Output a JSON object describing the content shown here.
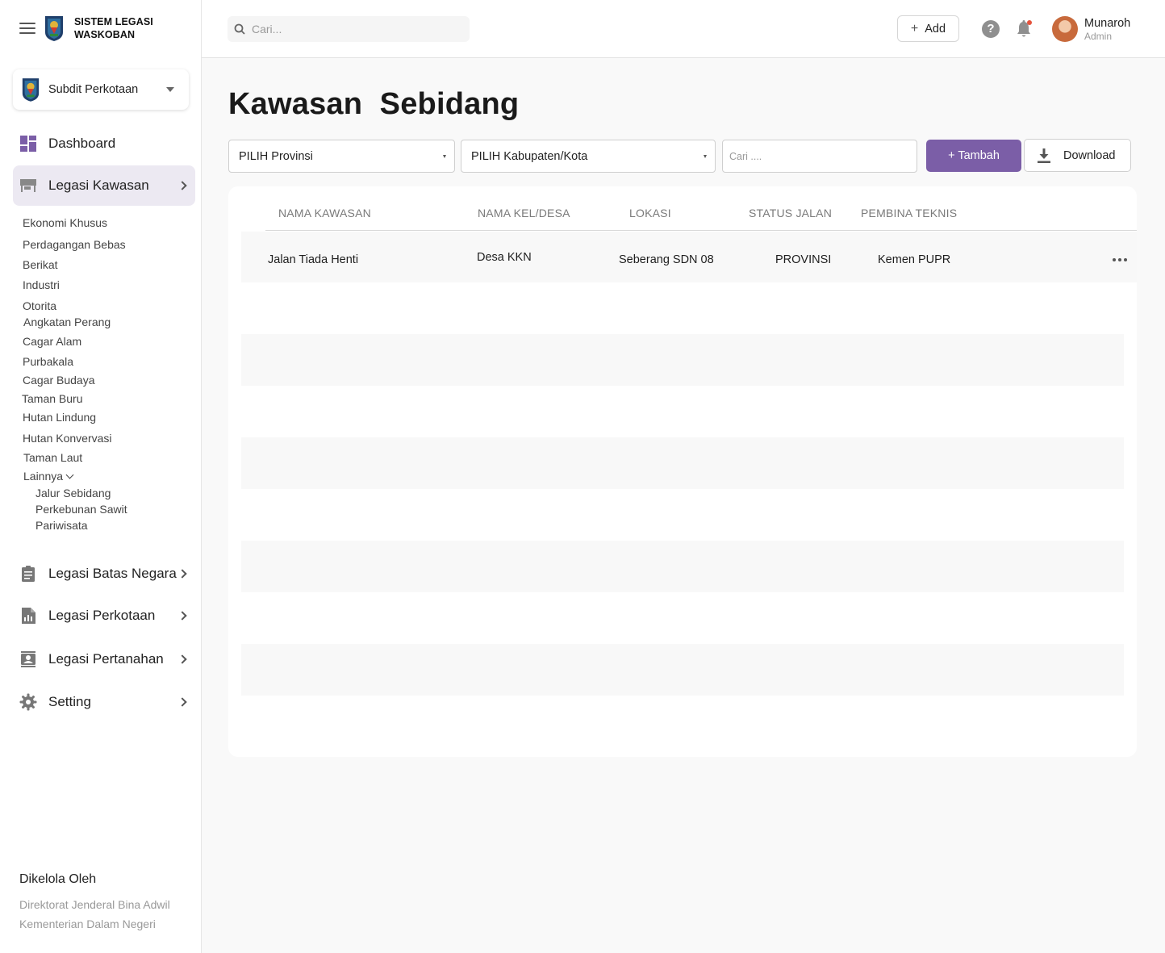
{
  "brand": {
    "line1": "SISTEM LEGASI",
    "line2": "WASKOBAN"
  },
  "org_select": {
    "label": "Subdit Perkotaan"
  },
  "nav": {
    "dashboard": "Dashboard",
    "legasi_kawasan": "Legasi Kawasan",
    "sub_items": [
      "Ekonomi Khusus",
      "Perdagangan Bebas",
      "Berikat",
      "Industri",
      "Otorita",
      "Angkatan Perang",
      "Cagar Alam",
      "Purbakala",
      "Cagar Budaya",
      "Taman Buru",
      "Hutan Lindung",
      "Hutan Konvervasi",
      "Taman Laut",
      "Lainnya"
    ],
    "lainnya_items": [
      "Jalur Sebidang",
      "Perkebunan Sawit",
      "Pariwisata"
    ],
    "batas_negara": "Legasi Batas Negara",
    "perkotaan": "Legasi Perkotaan",
    "pertanahan": "Legasi Pertanahan",
    "setting": "Setting"
  },
  "footer": {
    "title": "Dikelola Oleh",
    "line1": "Direktorat Jenderal Bina Adwil",
    "line2": "Kementerian Dalam Negeri"
  },
  "topbar": {
    "search_placeholder": "Cari...",
    "add_label": "Add",
    "help": "?",
    "user_name": "Munaroh",
    "user_role": "Admin"
  },
  "page": {
    "title": "Kawasan  Sebidang",
    "provinsi_select": "PILIH Provinsi",
    "kabupaten_select": "PILIH Kabupaten/Kota",
    "search_placeholder": "Cari ....",
    "tambah_label": "+ Tambah",
    "download_label": "Download"
  },
  "table": {
    "columns": [
      "NAMA KAWASAN",
      "NAMA KEL/DESA",
      "LOKASI",
      "STATUS JALAN",
      "PEMBINA TEKNIS"
    ],
    "rows": [
      [
        "Jalan Tiada Henti",
        "Desa KKN",
        "Seberang SDN 08",
        "PROVINSI",
        "Kemen PUPR"
      ]
    ]
  },
  "colors": {
    "accent": "#7b5ea7",
    "active_nav": "#ece9f2",
    "notification": "#e5533d"
  }
}
